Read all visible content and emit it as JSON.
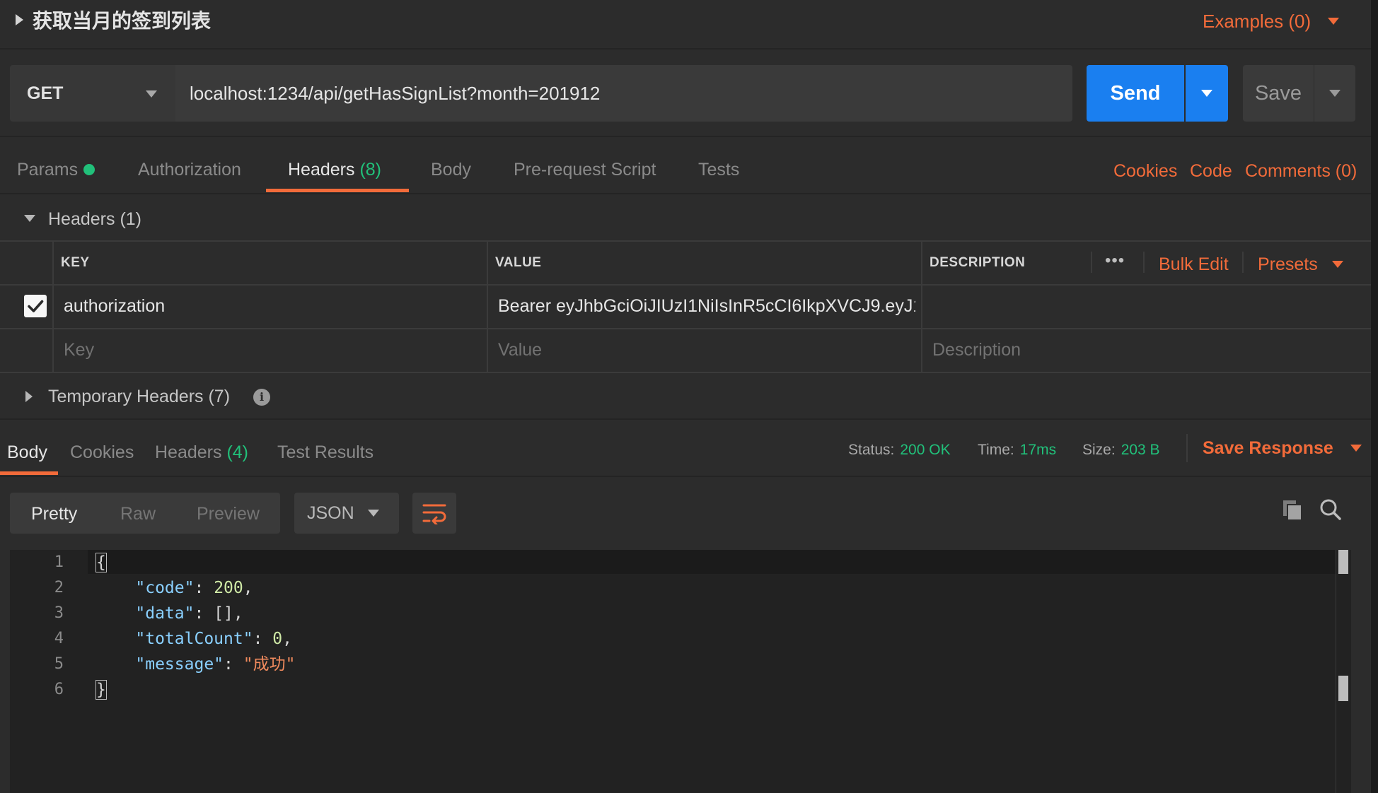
{
  "request": {
    "title": "获取当月的签到列表",
    "examples_label": "Examples (0)",
    "method": "GET",
    "url": "localhost:1234/api/getHasSignList?month=201912",
    "send_label": "Send",
    "save_label": "Save"
  },
  "request_tabs": {
    "params": "Params",
    "authorization": "Authorization",
    "headers": "Headers",
    "headers_count": "(8)",
    "body": "Body",
    "prerequest": "Pre-request Script",
    "tests": "Tests",
    "active": "Headers"
  },
  "request_links": {
    "cookies": "Cookies",
    "code": "Code",
    "comments": "Comments (0)"
  },
  "headers_section": {
    "title": "Headers (1)",
    "columns": {
      "key": "KEY",
      "value": "VALUE",
      "description": "DESCRIPTION"
    },
    "more_label": "•••",
    "bulk_edit": "Bulk Edit",
    "presets": "Presets",
    "rows": [
      {
        "enabled": true,
        "key": "authorization",
        "value": "Bearer eyJhbGciOiJIUzI1NiIsInR5cCI6IkpXVCJ9.eyJ1...",
        "description": ""
      }
    ],
    "placeholders": {
      "key": "Key",
      "value": "Value",
      "description": "Description"
    },
    "temporary_title": "Temporary Headers (7)",
    "info_icon": "info-icon"
  },
  "response_tabs": {
    "body": "Body",
    "cookies": "Cookies",
    "headers": "Headers",
    "headers_count": "(4)",
    "tests": "Test Results",
    "active": "Body"
  },
  "response_status": {
    "status_label": "Status:",
    "status_value": "200 OK",
    "time_label": "Time:",
    "time_value": "17ms",
    "size_label": "Size:",
    "size_value": "203 B",
    "save_response": "Save Response"
  },
  "response_toolbar": {
    "views": [
      "Pretty",
      "Raw",
      "Preview"
    ],
    "active_view": "Pretty",
    "format": "JSON",
    "wrap_icon": "wrap-lines-icon",
    "copy_icon": "copy-icon",
    "search_icon": "search-icon"
  },
  "response_body": {
    "line_numbers": [
      "1",
      "2",
      "3",
      "4",
      "5",
      "6"
    ],
    "lines": {
      "l1": "{",
      "l2_key": "\"code\"",
      "l2_val": "200",
      "l3_key": "\"data\"",
      "l3_val": "[]",
      "l4_key": "\"totalCount\"",
      "l4_val": "0",
      "l5_key": "\"message\"",
      "l5_val": "\"成功\"",
      "l6": "}"
    }
  },
  "colors": {
    "accent": "#f26b3a",
    "send_blue": "#1a7ff0",
    "success_green": "#21c07a",
    "background": "#2c2c2c"
  }
}
